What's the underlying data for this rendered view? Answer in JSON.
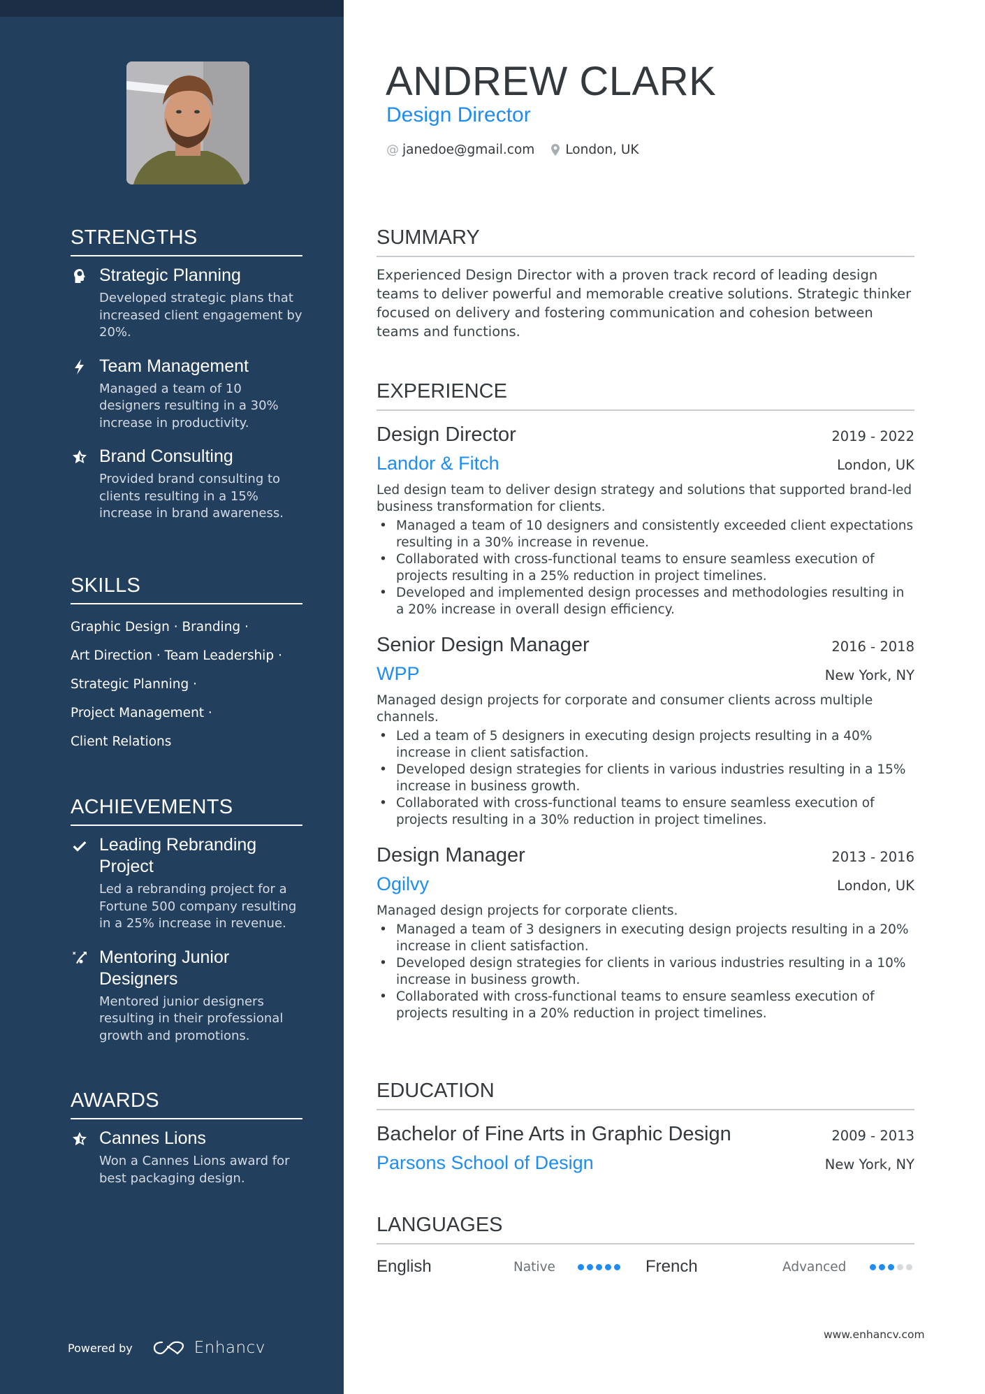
{
  "header": {
    "name": "ANDREW CLARK",
    "role": "Design Director",
    "email": "janedoe@gmail.com",
    "location": "London, UK",
    "email_icon": "at-icon",
    "location_icon": "map-pin-icon"
  },
  "colors": {
    "sidebar": "#233f5e",
    "sidebar_top": "#1b2d45",
    "accent": "#1e8cf0",
    "text": "#33393d"
  },
  "sidebar": {
    "photo_alt": "Profile photo",
    "strengths": {
      "title": "STRENGTHS",
      "items": [
        {
          "icon": "head-brain-icon",
          "title": "Strategic Planning",
          "desc": "Developed strategic plans that increased client engagement by 20%."
        },
        {
          "icon": "lightning-bolt-icon",
          "title": "Team Management",
          "desc": "Managed a team of 10 designers resulting in a 30% increase in productivity."
        },
        {
          "icon": "half-star-icon",
          "title": "Brand Consulting",
          "desc": "Provided brand consulting to clients resulting in a 15% increase in brand awareness."
        }
      ]
    },
    "skills": {
      "title": "SKILLS",
      "lines": [
        "Graphic Design · Branding ·",
        "Art Direction · Team Leadership ·",
        "Strategic Planning ·",
        "Project Management ·",
        "Client Relations"
      ]
    },
    "achievements": {
      "title": "ACHIEVEMENTS",
      "items": [
        {
          "icon": "checkmark-icon",
          "title": "Leading Rebranding Project",
          "desc": "Led a rebranding project for a Fortune 500 company resulting in a 25% increase in revenue."
        },
        {
          "icon": "strategy-play-icon",
          "title": "Mentoring Junior Designers",
          "desc": "Mentored junior designers resulting in their professional growth and promotions."
        }
      ]
    },
    "awards": {
      "title": "AWARDS",
      "items": [
        {
          "icon": "half-star-icon",
          "title": "Cannes Lions",
          "desc": "Won a Cannes Lions award for best packaging design."
        }
      ]
    },
    "powered_by": "Powered by",
    "brand": "Enhancv"
  },
  "main": {
    "summary": {
      "title": "SUMMARY",
      "text": "Experienced Design Director with a proven track record of leading design teams to deliver powerful and memorable creative solutions. Strategic thinker focused on delivery and fostering communication and cohesion between teams and functions."
    },
    "experience": {
      "title": "EXPERIENCE",
      "jobs": [
        {
          "title": "Design Director",
          "dates": "2019 - 2022",
          "company": "Landor & Fitch",
          "location": "London, UK",
          "description": "Led design team to deliver design strategy and solutions that supported brand-led business transformation for clients.",
          "bullets": [
            "Managed a team of 10 designers and consistently exceeded client expectations resulting in a 30% increase in revenue.",
            "Collaborated with cross-functional teams to ensure seamless execution of projects resulting in a 25% reduction in project timelines.",
            "Developed and implemented design processes and methodologies resulting in a 20% increase in overall design efficiency."
          ]
        },
        {
          "title": "Senior Design Manager",
          "dates": "2016 - 2018",
          "company": "WPP",
          "location": "New York, NY",
          "description": "Managed design projects for corporate and consumer clients across multiple channels.",
          "bullets": [
            "Led a team of 5 designers in executing design projects resulting in a 40% increase in client satisfaction.",
            "Developed design strategies for clients in various industries resulting in a 15% increase in business growth.",
            "Collaborated with cross-functional teams to ensure seamless execution of projects resulting in a 30% reduction in project timelines."
          ]
        },
        {
          "title": "Design Manager",
          "dates": "2013 - 2016",
          "company": "Ogilvy",
          "location": "London, UK",
          "description": "Managed design projects for corporate clients.",
          "bullets": [
            "Managed a team of 3 designers in executing design projects resulting in a 20% increase in client satisfaction.",
            "Developed design strategies for clients in various industries resulting in a 10% increase in business growth.",
            "Collaborated with cross-functional teams to ensure seamless execution of projects resulting in a 20% reduction in project timelines."
          ]
        }
      ]
    },
    "education": {
      "title": "EDUCATION",
      "items": [
        {
          "degree": "Bachelor of Fine Arts in Graphic Design",
          "dates": "2009 - 2013",
          "school": "Parsons School of Design",
          "location": "New York, NY"
        }
      ]
    },
    "languages": {
      "title": "LANGUAGES",
      "items": [
        {
          "name": "English",
          "level": "Native",
          "rating": 5,
          "max": 5
        },
        {
          "name": "French",
          "level": "Advanced",
          "rating": 3,
          "max": 5
        }
      ]
    }
  },
  "footer": {
    "url": "www.enhancv.com"
  }
}
